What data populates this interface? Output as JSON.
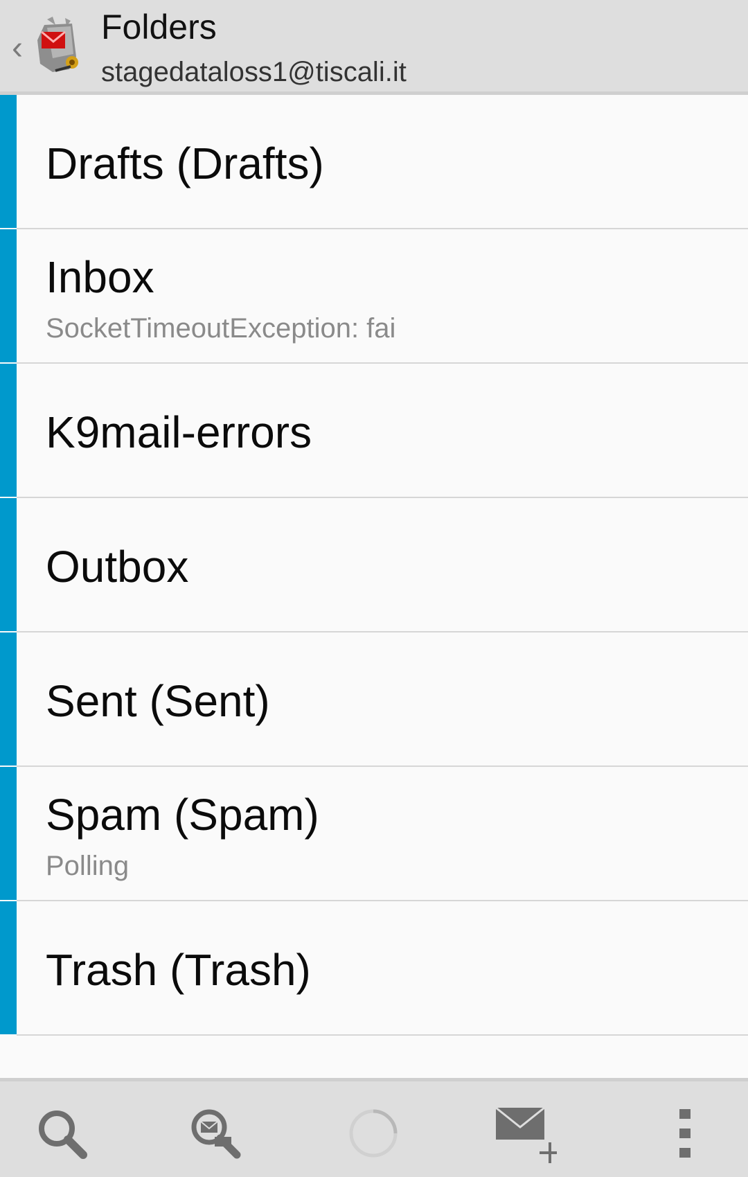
{
  "header": {
    "title": "Folders",
    "account": "stagedataloss1@tiscali.it"
  },
  "folders": [
    {
      "name": "Drafts (Drafts)",
      "status": ""
    },
    {
      "name": "Inbox",
      "status": "SocketTimeoutException: fai"
    },
    {
      "name": "K9mail-errors",
      "status": ""
    },
    {
      "name": "Outbox",
      "status": ""
    },
    {
      "name": "Sent (Sent)",
      "status": ""
    },
    {
      "name": "Spam (Spam)",
      "status": "Polling"
    },
    {
      "name": "Trash (Trash)",
      "status": ""
    }
  ],
  "bottom_bar": {
    "icons": [
      "search-icon",
      "search-messages-icon",
      "refresh-spinner-icon",
      "compose-icon",
      "overflow-menu-icon"
    ]
  },
  "colors": {
    "accent": "#0099cc",
    "bar": "#dedede"
  }
}
